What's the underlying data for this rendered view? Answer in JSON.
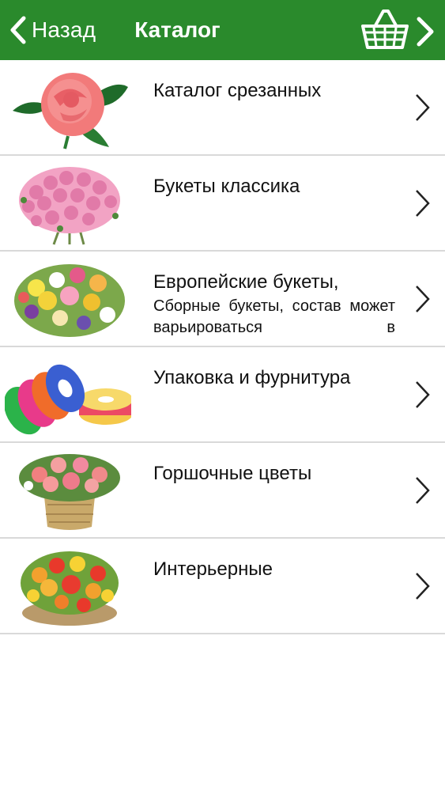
{
  "header": {
    "back_label": "Назад",
    "title": "Каталог",
    "bg_color": "#2a8a2c",
    "icons": {
      "back": "chevron-left-icon",
      "cart": "basket-icon",
      "forward": "chevron-right-icon"
    }
  },
  "catalog": {
    "items": [
      {
        "title": "Каталог срезанных",
        "desc": "",
        "image": "red-rose-image"
      },
      {
        "title": "Букеты классика",
        "desc": "",
        "image": "pink-rose-bouquet-image"
      },
      {
        "title": "Европейские букеты,",
        "desc": "Сборные букеты, состав может варьироваться в",
        "image": "mixed-bouquet-image"
      },
      {
        "title": "Упаковка и фурнитура",
        "desc": "",
        "image": "ribbon-rolls-image"
      },
      {
        "title": "Горшочные цветы",
        "desc": "",
        "image": "potted-flowers-image"
      },
      {
        "title": "Интерьерные",
        "desc": "",
        "image": "interior-arrangement-image"
      }
    ]
  }
}
